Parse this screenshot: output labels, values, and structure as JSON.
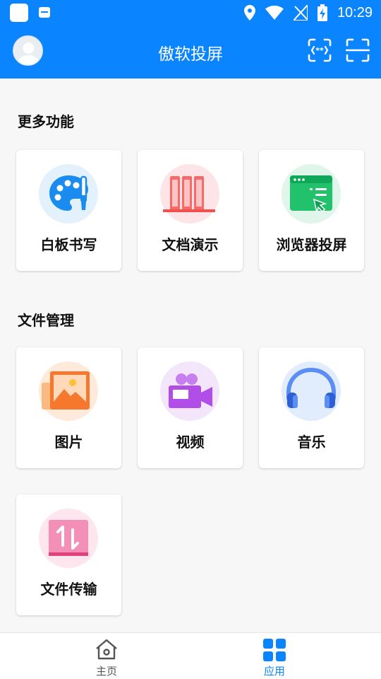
{
  "status_bar": {
    "time": "10:29"
  },
  "header": {
    "title": "傲软投屏"
  },
  "sections": [
    {
      "title": "更多功能",
      "items": [
        {
          "label": "白板书写",
          "icon": "palette-icon"
        },
        {
          "label": "文档演示",
          "icon": "document-presentation-icon"
        },
        {
          "label": "浏览器投屏",
          "icon": "browser-cast-icon"
        }
      ]
    },
    {
      "title": "文件管理",
      "items": [
        {
          "label": "图片",
          "icon": "image-icon"
        },
        {
          "label": "视频",
          "icon": "video-camera-icon"
        },
        {
          "label": "音乐",
          "icon": "headphones-icon"
        },
        {
          "label": "文件传输",
          "icon": "file-transfer-icon"
        }
      ]
    }
  ],
  "bottom_nav": {
    "items": [
      {
        "label": "主页",
        "icon": "home-icon",
        "active": false
      },
      {
        "label": "应用",
        "icon": "apps-grid-icon",
        "active": true
      }
    ],
    "active_color": "#0a84ff",
    "inactive_color": "#555555"
  },
  "colors": {
    "brand": "#0a84ff"
  }
}
